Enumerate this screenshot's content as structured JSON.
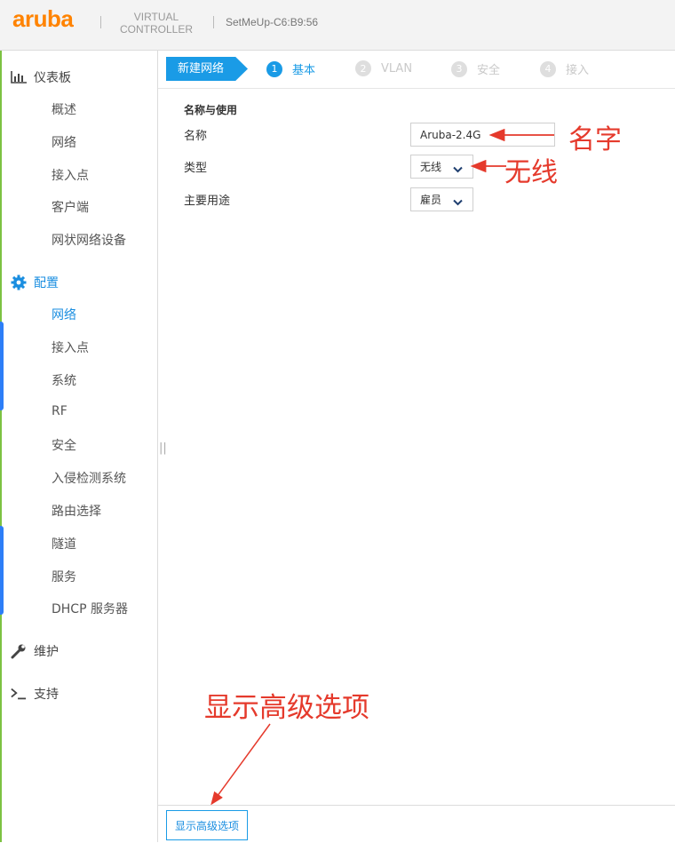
{
  "header": {
    "logo_text": "aruba",
    "vc_line1": "VIRTUAL",
    "vc_line2": "CONTROLLER",
    "device_name": "SetMeUp-C6:B9:56"
  },
  "sidebar": {
    "dashboard": {
      "label": "仪表板",
      "items": [
        "概述",
        "网络",
        "接入点",
        "客户端",
        "网状网络设备"
      ]
    },
    "config": {
      "label": "配置",
      "items": [
        "网络",
        "接入点",
        "系统",
        "RF",
        "安全",
        "入侵检测系统",
        "路由选择",
        "隧道",
        "服务",
        "DHCP 服务器"
      ]
    },
    "maintenance": {
      "label": "维护"
    },
    "support": {
      "label": "支持"
    }
  },
  "wizard": {
    "current_label": "新建网络",
    "steps": [
      {
        "num": "1",
        "label": "基本"
      },
      {
        "num": "2",
        "label": "VLAN"
      },
      {
        "num": "3",
        "label": "安全"
      },
      {
        "num": "4",
        "label": "接入"
      }
    ]
  },
  "form": {
    "section_title": "名称与使用",
    "name_label": "名称",
    "name_value": "Aruba-2.4G",
    "type_label": "类型",
    "type_value": "无线",
    "usage_label": "主要用途",
    "usage_value": "雇员"
  },
  "annotations": {
    "name_note": "名字",
    "type_note": "无线",
    "advanced_note": "显示高级选项",
    "color": "#e53a2c"
  },
  "footer": {
    "advanced_button": "显示高级选项"
  },
  "colors": {
    "accent": "#1a9be6",
    "brand": "#ff8300",
    "sidebar_stripe": "#7cc242"
  }
}
